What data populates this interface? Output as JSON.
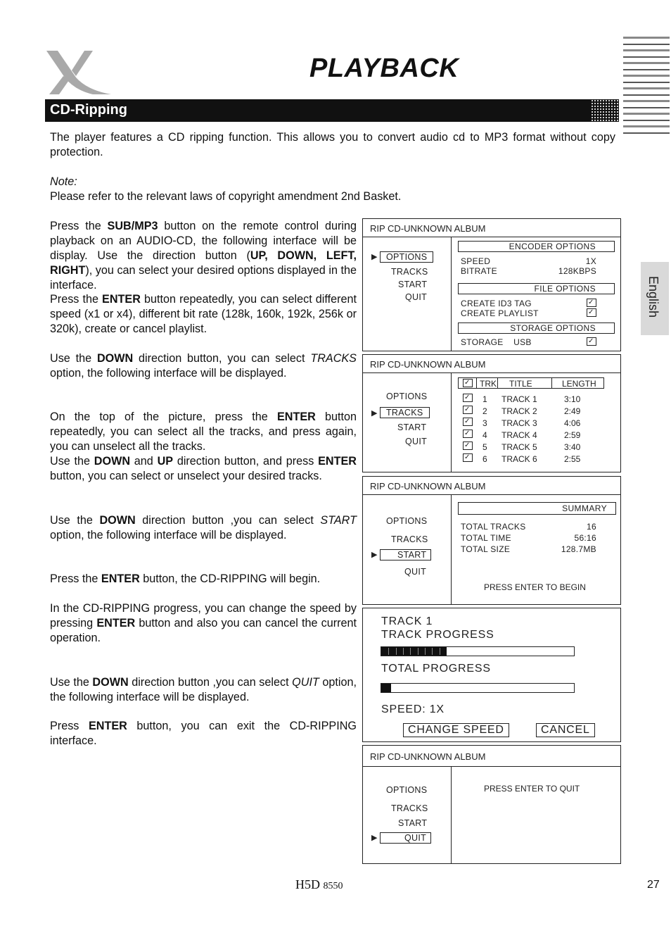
{
  "header": {
    "page_title": "PLAYBACK",
    "section_title": "CD-Ripping",
    "language_tab": "English"
  },
  "intro": {
    "text": "The player features a CD ripping function. This allows you to convert audio cd to MP3 format without copy protection.",
    "note_label": "Note:",
    "note_text": "Please refer to the relevant laws of copyright amendment 2nd Basket."
  },
  "paragraphs": {
    "p1_a": "Press the ",
    "p1_b": "SUB/MP3",
    "p1_c": " button on the remote control during playback on an AUDIO-CD, the following interface will be display. Use the direction button (",
    "p1_d": "UP, DOWN, LEFT, RIGHT",
    "p1_e": "), you can select your desired options displayed in the interface.",
    "p2_a": "Press the ",
    "p2_b": "ENTER",
    "p2_c": " button repeatedly, you can select different speed (x1 or x4), different bit rate (128k, 160k, 192k, 256k or 320k), create or cancel playlist.",
    "p3_a": "Use the ",
    "p3_b": "DOWN",
    "p3_c": " direction button, you can select ",
    "p3_d": "TRACKS",
    "p3_e": " option, the following interface will be displayed.",
    "p4_a": "On the top of the picture, press the ",
    "p4_b": "ENTER",
    "p4_c": " button repeatedly, you can select all the tracks, and press again, you can unselect all the tracks.",
    "p5_a": "Use the ",
    "p5_b": "DOWN",
    "p5_c": " and ",
    "p5_d": "UP",
    "p5_e": " direction button, and press ",
    "p5_f": "ENTER",
    "p5_g": " button, you can select or unselect your desired tracks.",
    "p6_a": "Use the ",
    "p6_b": "DOWN",
    "p6_c": " direction button ,you can select ",
    "p6_d": "START",
    "p6_e": " option, the following interface will be displayed.",
    "p7_a": "Press the ",
    "p7_b": "ENTER",
    "p7_c": " button, the CD-RIPPING will begin.",
    "p8_a": " In the CD-RIPPING progress, you can change the speed by pressing ",
    "p8_b": "ENTER",
    "p8_c": " button and also you can cancel the current operation.",
    "p9_a": "Use the ",
    "p9_b": "DOWN",
    "p9_c": " direction button ,you can select ",
    "p9_d": "QUIT",
    "p9_e": " option, the following interface will be displayed.",
    "p10_a": "Press ",
    "p10_b": "ENTER",
    "p10_c": " button, you can exit the CD-RIPPING interface."
  },
  "screens": {
    "album_header": "RIP CD-UNKNOWN ALBUM",
    "menu": [
      "OPTIONS",
      "TRACKS",
      "START",
      "QUIT"
    ],
    "options": {
      "encoder_header": "ENCODER  OPTIONS",
      "speed_label": "SPEED",
      "speed_value": "1X",
      "bitrate_label": "BITRATE",
      "bitrate_value": "128KBPS",
      "file_header": "FILE OPTIONS",
      "id3_label": "CREATE ID3 TAG",
      "playlist_label": "CREATE PLAYLIST",
      "storage_header": "STORAGE  OPTIONS",
      "storage_label": "STORAGE",
      "storage_value": "USB"
    },
    "tracks": {
      "columns": [
        "TRK",
        "TITLE",
        "LENGTH"
      ],
      "rows": [
        {
          "trk": "1",
          "title": "TRACK 1",
          "length": "3:10"
        },
        {
          "trk": "2",
          "title": "TRACK 2",
          "length": "2:49"
        },
        {
          "trk": "3",
          "title": "TRACK 3",
          "length": "4:06"
        },
        {
          "trk": "4",
          "title": "TRACK 4",
          "length": "2:59"
        },
        {
          "trk": "5",
          "title": "TRACK 5",
          "length": "3:40"
        },
        {
          "trk": "6",
          "title": "TRACK 6",
          "length": "2:55"
        }
      ]
    },
    "summary": {
      "header": "SUMMARY",
      "total_tracks_label": "TOTAL TRACKS",
      "total_tracks_value": "16",
      "total_time_label": "TOTAL TIME",
      "total_time_value": "56:16",
      "total_size_label": "TOTAL SIZE",
      "total_size_value": "128.7MB",
      "prompt": "PRESS ENTER TO BEGIN"
    },
    "progress": {
      "track_label": "TRACK 1",
      "track_progress_label": "TRACK PROGRESS",
      "track_progress_percent": 34,
      "total_progress_label": "TOTAL PROGRESS",
      "total_progress_percent": 5,
      "speed_label": "SPEED: 1X",
      "change_speed_button": "CHANGE SPEED",
      "cancel_button": "CANCEL"
    },
    "quit": {
      "prompt": "PRESS ENTER TO QUIT"
    }
  },
  "footer": {
    "model_prefix": "H5D",
    "model_number": "8550",
    "page_number": "27"
  }
}
